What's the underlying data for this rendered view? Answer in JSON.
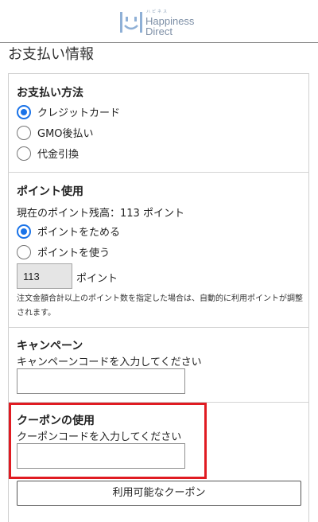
{
  "header": {
    "logo_small": "ハピネス",
    "logo_line1": "Happiness",
    "logo_line2": "Direct"
  },
  "page_title": "お支払い情報",
  "payment": {
    "title": "お支払い方法",
    "options": [
      {
        "label": "クレジットカード",
        "checked": true
      },
      {
        "label": "GMO後払い",
        "checked": false
      },
      {
        "label": "代金引換",
        "checked": false
      }
    ]
  },
  "points": {
    "title": "ポイント使用",
    "balance_text": "現在のポイント残高：113 ポイント",
    "options": [
      {
        "label": "ポイントをためる",
        "checked": true
      },
      {
        "label": "ポイントを使う",
        "checked": false
      }
    ],
    "input_value": "113",
    "unit": "ポイント",
    "note": "注文金額合計以上のポイント数を指定した場合は、自動的に利用ポイントが調整されます。"
  },
  "campaign": {
    "title": "キャンペーン",
    "instruction": "キャンペーンコードを入力してください",
    "value": ""
  },
  "coupon": {
    "title": "クーポンの使用",
    "instruction": "クーポンコードを入力してください",
    "value": "",
    "button_label": "利用可能なクーポン"
  },
  "colors": {
    "accent": "#1a73e8",
    "highlight": "#e01b22",
    "logo": "#7d8fa6"
  }
}
